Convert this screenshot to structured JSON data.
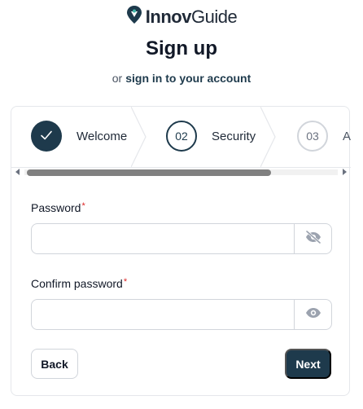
{
  "brand": {
    "name_bold": "Innov",
    "name_light": "Guide"
  },
  "header": {
    "title": "Sign up",
    "subtitle_prefix": "or",
    "subtitle_link": "sign in to your account"
  },
  "steps": [
    {
      "number": "✓",
      "label": "Welcome",
      "state": "complete"
    },
    {
      "number": "02",
      "label": "Security",
      "state": "current"
    },
    {
      "number": "03",
      "label": "A",
      "state": "upcoming"
    }
  ],
  "form": {
    "password_label": "Password",
    "password_value": "",
    "confirm_label": "Confirm password",
    "confirm_value": "",
    "required_mark": "*"
  },
  "actions": {
    "back_label": "Back",
    "next_label": "Next"
  },
  "colors": {
    "primary": "#1e3a4c",
    "required": "#dc2626",
    "border": "#d1d5db"
  },
  "icons": {
    "logo": "location-pin-logo-icon",
    "hide_password": "eye-slash-icon",
    "show_password": "eye-icon",
    "step_done": "checkmark-icon"
  }
}
